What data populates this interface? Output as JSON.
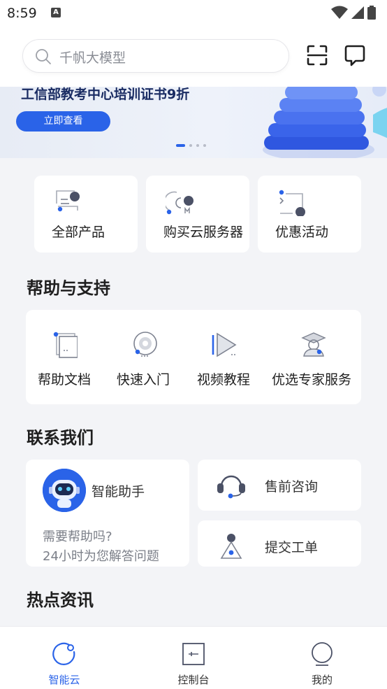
{
  "status_bar": {
    "time": "8:59"
  },
  "search": {
    "placeholder": "千帆大模型"
  },
  "banner": {
    "title": "工信部教考中心培训证书9折",
    "button_label": "立即查看",
    "page_count": 4,
    "active_page": 1
  },
  "quick_actions": [
    {
      "label": "全部产品",
      "icon": "all-products-icon"
    },
    {
      "label": "购买云服务器",
      "icon": "cloud-server-icon"
    },
    {
      "label": "优惠活动",
      "icon": "promotion-icon"
    }
  ],
  "help": {
    "title": "帮助与支持",
    "items": [
      {
        "label": "帮助文档",
        "icon": "document-icon"
      },
      {
        "label": "快速入门",
        "icon": "quick-start-icon"
      },
      {
        "label": "视频教程",
        "icon": "video-icon"
      },
      {
        "label": "优选专家服务",
        "icon": "expert-icon"
      }
    ]
  },
  "contact": {
    "title": "联系我们",
    "assistant": {
      "name": "智能助手",
      "line1": "需要帮助吗?",
      "line2": "24小时为您解答问题"
    },
    "presales": {
      "label": "售前咨询"
    },
    "ticket": {
      "label": "提交工单"
    }
  },
  "news": {
    "title": "热点资讯"
  },
  "bottom_nav": {
    "items": [
      {
        "label": "智能云",
        "active": true
      },
      {
        "label": "控制台",
        "active": false
      },
      {
        "label": "我的",
        "active": false
      }
    ]
  },
  "colors": {
    "accent": "#2a63e8",
    "navy": "#1a2c63",
    "background": "#f3f4f7"
  }
}
